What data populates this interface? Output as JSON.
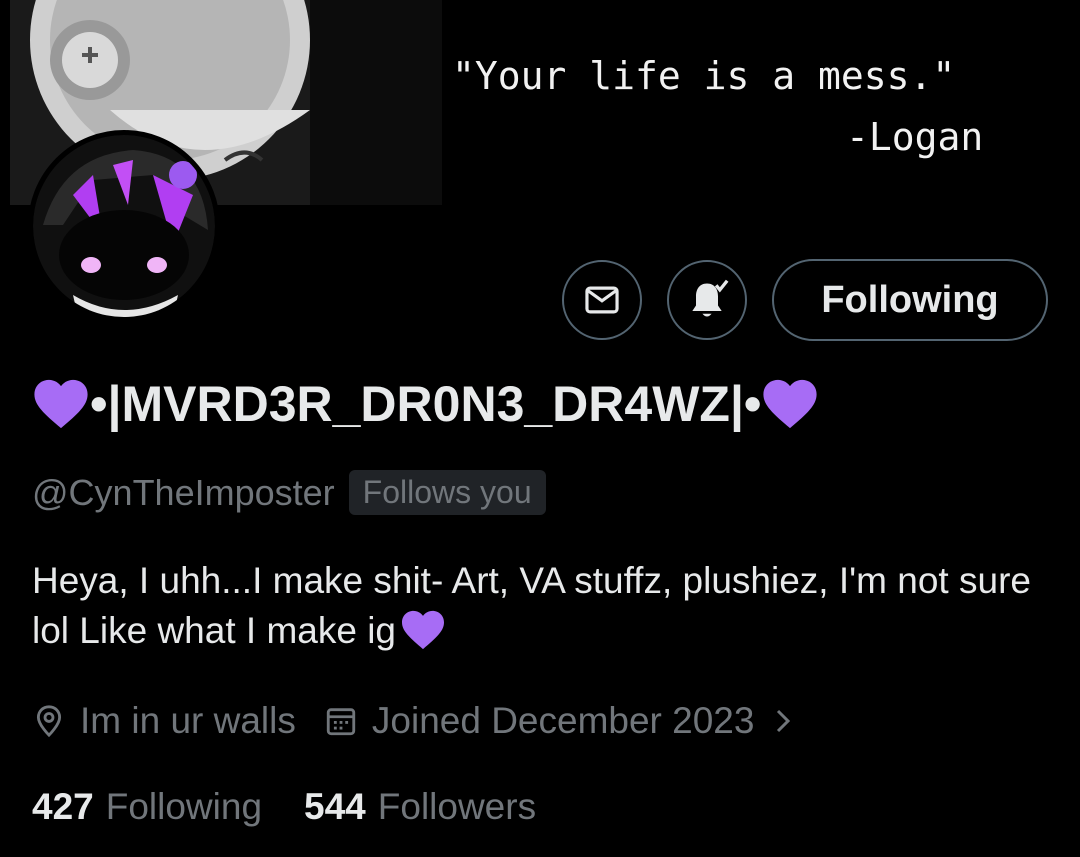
{
  "banner": {
    "quote": "\"Your life is a mess.\"",
    "quote_author": "-Logan"
  },
  "actions": {
    "message_icon": "envelope-icon",
    "notify_icon": "bell-check-icon",
    "follow_label": "Following"
  },
  "profile": {
    "display_name": "•|MVRD3R_DR0N3_DR4WZ|•",
    "handle": "@CynTheImposter",
    "follows_you": "Follows you",
    "bio": "Heya, I uhh...I make shit-  Art, VA stuffz, plushiez, I'm not sure lol Like what I make ig",
    "location": "Im in ur walls",
    "joined": "Joined December 2023",
    "following_count": "427",
    "following_label": "Following",
    "followers_count": "544",
    "followers_label": "Followers"
  },
  "colors": {
    "background": "#000000",
    "text_primary": "#e7e9ea",
    "text_secondary": "#71767b",
    "border": "#536471",
    "heart_purple": "#a76cf5"
  }
}
